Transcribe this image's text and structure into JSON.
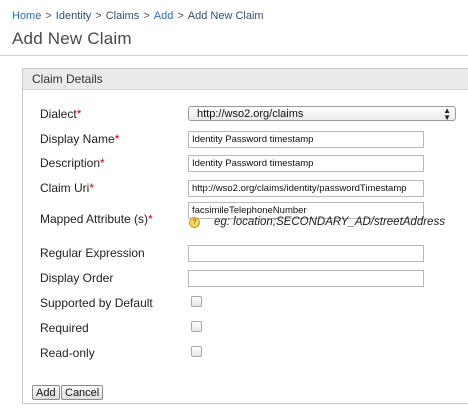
{
  "breadcrumb": [
    {
      "label": "Home",
      "link": true
    },
    {
      "label": "Identity",
      "link": false
    },
    {
      "label": "Claims",
      "link": false
    },
    {
      "label": "Add",
      "link": true
    },
    {
      "label": "Add New Claim",
      "link": false
    }
  ],
  "breadcrumb_separator": ">",
  "page_title": "Add New Claim",
  "panel": {
    "title": "Claim Details",
    "fields": {
      "dialect": {
        "label": "Dialect",
        "required": "*",
        "value": "http://wso2.org/claims"
      },
      "display_name": {
        "label": "Display Name",
        "required": "*",
        "value": "Identity Password timestamp"
      },
      "description": {
        "label": "Description",
        "required": "*",
        "value": "Identity Password timestamp"
      },
      "claim_uri": {
        "label": "Claim Uri",
        "required": "*",
        "value": "http://wso2.org/claims/identity/passwordTimestamp"
      },
      "mapped_attribute": {
        "label": "Mapped Attribute (s)",
        "required": "*",
        "value": "facsimileTelephoneNumber",
        "hint": "eg: location;SECONDARY_AD/streetAddress",
        "help_icon": "?"
      },
      "regular_expression": {
        "label": "Regular Expression",
        "value": ""
      },
      "display_order": {
        "label": "Display Order",
        "value": ""
      },
      "supported_by_default": {
        "label": "Supported by Default",
        "checked": false
      },
      "required": {
        "label": "Required",
        "checked": false
      },
      "read_only": {
        "label": "Read-only",
        "checked": false
      }
    }
  },
  "buttons": {
    "add": "Add",
    "cancel": "Cancel"
  }
}
